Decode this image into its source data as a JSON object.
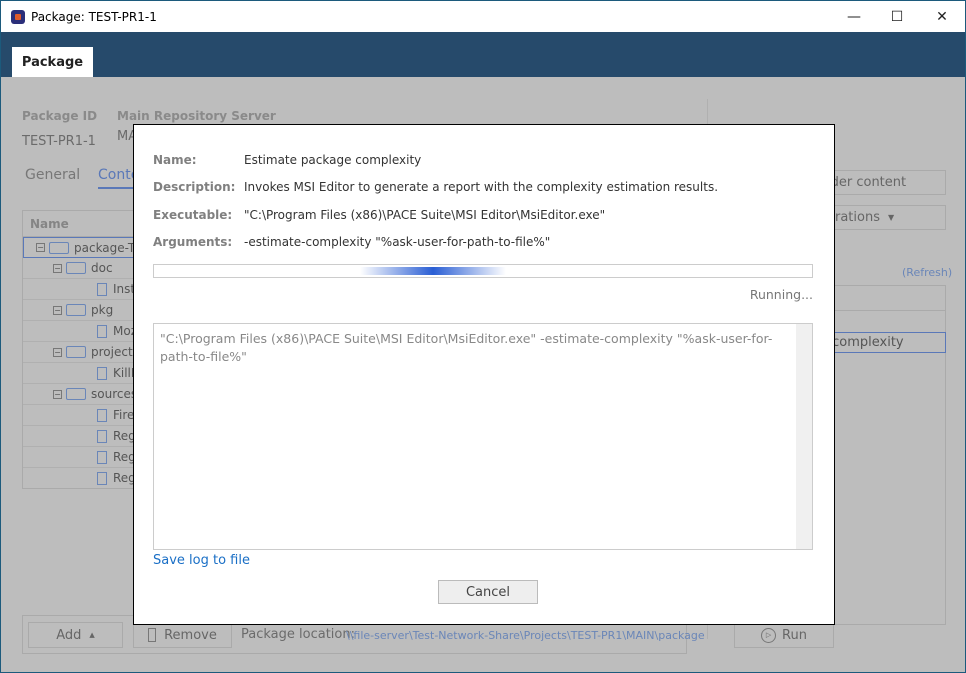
{
  "window": {
    "title": "Package: TEST-PR1-1",
    "minimize": "—",
    "maximize": "☐",
    "close": "✕"
  },
  "header": {
    "tab": "Package"
  },
  "package": {
    "id_label": "Package ID",
    "id_value": "TEST-PR1-1",
    "server_label": "Main Repository Server",
    "server_value": "MA"
  },
  "subtabs": [
    "General",
    "Conte"
  ],
  "tree": {
    "header": "Name",
    "items": [
      {
        "label": "package-T",
        "level": 0,
        "type": "folder"
      },
      {
        "label": "doc",
        "level": 1,
        "type": "folder"
      },
      {
        "label": "Instal",
        "level": 2,
        "type": "file"
      },
      {
        "label": "pkg",
        "level": 1,
        "type": "folder"
      },
      {
        "label": "Mozi",
        "level": 2,
        "type": "file"
      },
      {
        "label": "project",
        "level": 1,
        "type": "folder"
      },
      {
        "label": "KillPr",
        "level": 2,
        "type": "file"
      },
      {
        "label": "sources",
        "level": 1,
        "type": "folder"
      },
      {
        "label": "Firefo",
        "level": 2,
        "type": "file"
      },
      {
        "label": "Regis",
        "level": 2,
        "type": "file"
      },
      {
        "label": "Regis",
        "level": 2,
        "type": "file"
      },
      {
        "label": "Regis",
        "level": 2,
        "type": "file"
      }
    ]
  },
  "right": {
    "folder_content": "lder content",
    "operations": "erations",
    "refresh": "(Refresh)",
    "selected_op": "e complexity",
    "run": "Run"
  },
  "bottom": {
    "add": "Add",
    "remove": "Remove",
    "location_label": "Package location:",
    "location_value": "\\\\file-server\\Test-Network-Share\\Projects\\TEST-PR1\\MAIN\\package"
  },
  "dialog": {
    "name_label": "Name:",
    "name_value": "Estimate package complexity",
    "desc_label": "Description:",
    "desc_value": "Invokes MSI Editor to generate a report with the complexity estimation results.",
    "exe_label": "Executable:",
    "exe_value": "\"C:\\Program Files (x86)\\PACE Suite\\MSI Editor\\MsiEditor.exe\"",
    "args_label": "Arguments:",
    "args_value": "-estimate-complexity \"%ask-user-for-path-to-file%\"",
    "status": "Running...",
    "log": "\"C:\\Program Files (x86)\\PACE Suite\\MSI Editor\\MsiEditor.exe\" -estimate-complexity \"%ask-user-for-path-to-file%\"",
    "save_log": "Save log to file",
    "cancel": "Cancel"
  }
}
